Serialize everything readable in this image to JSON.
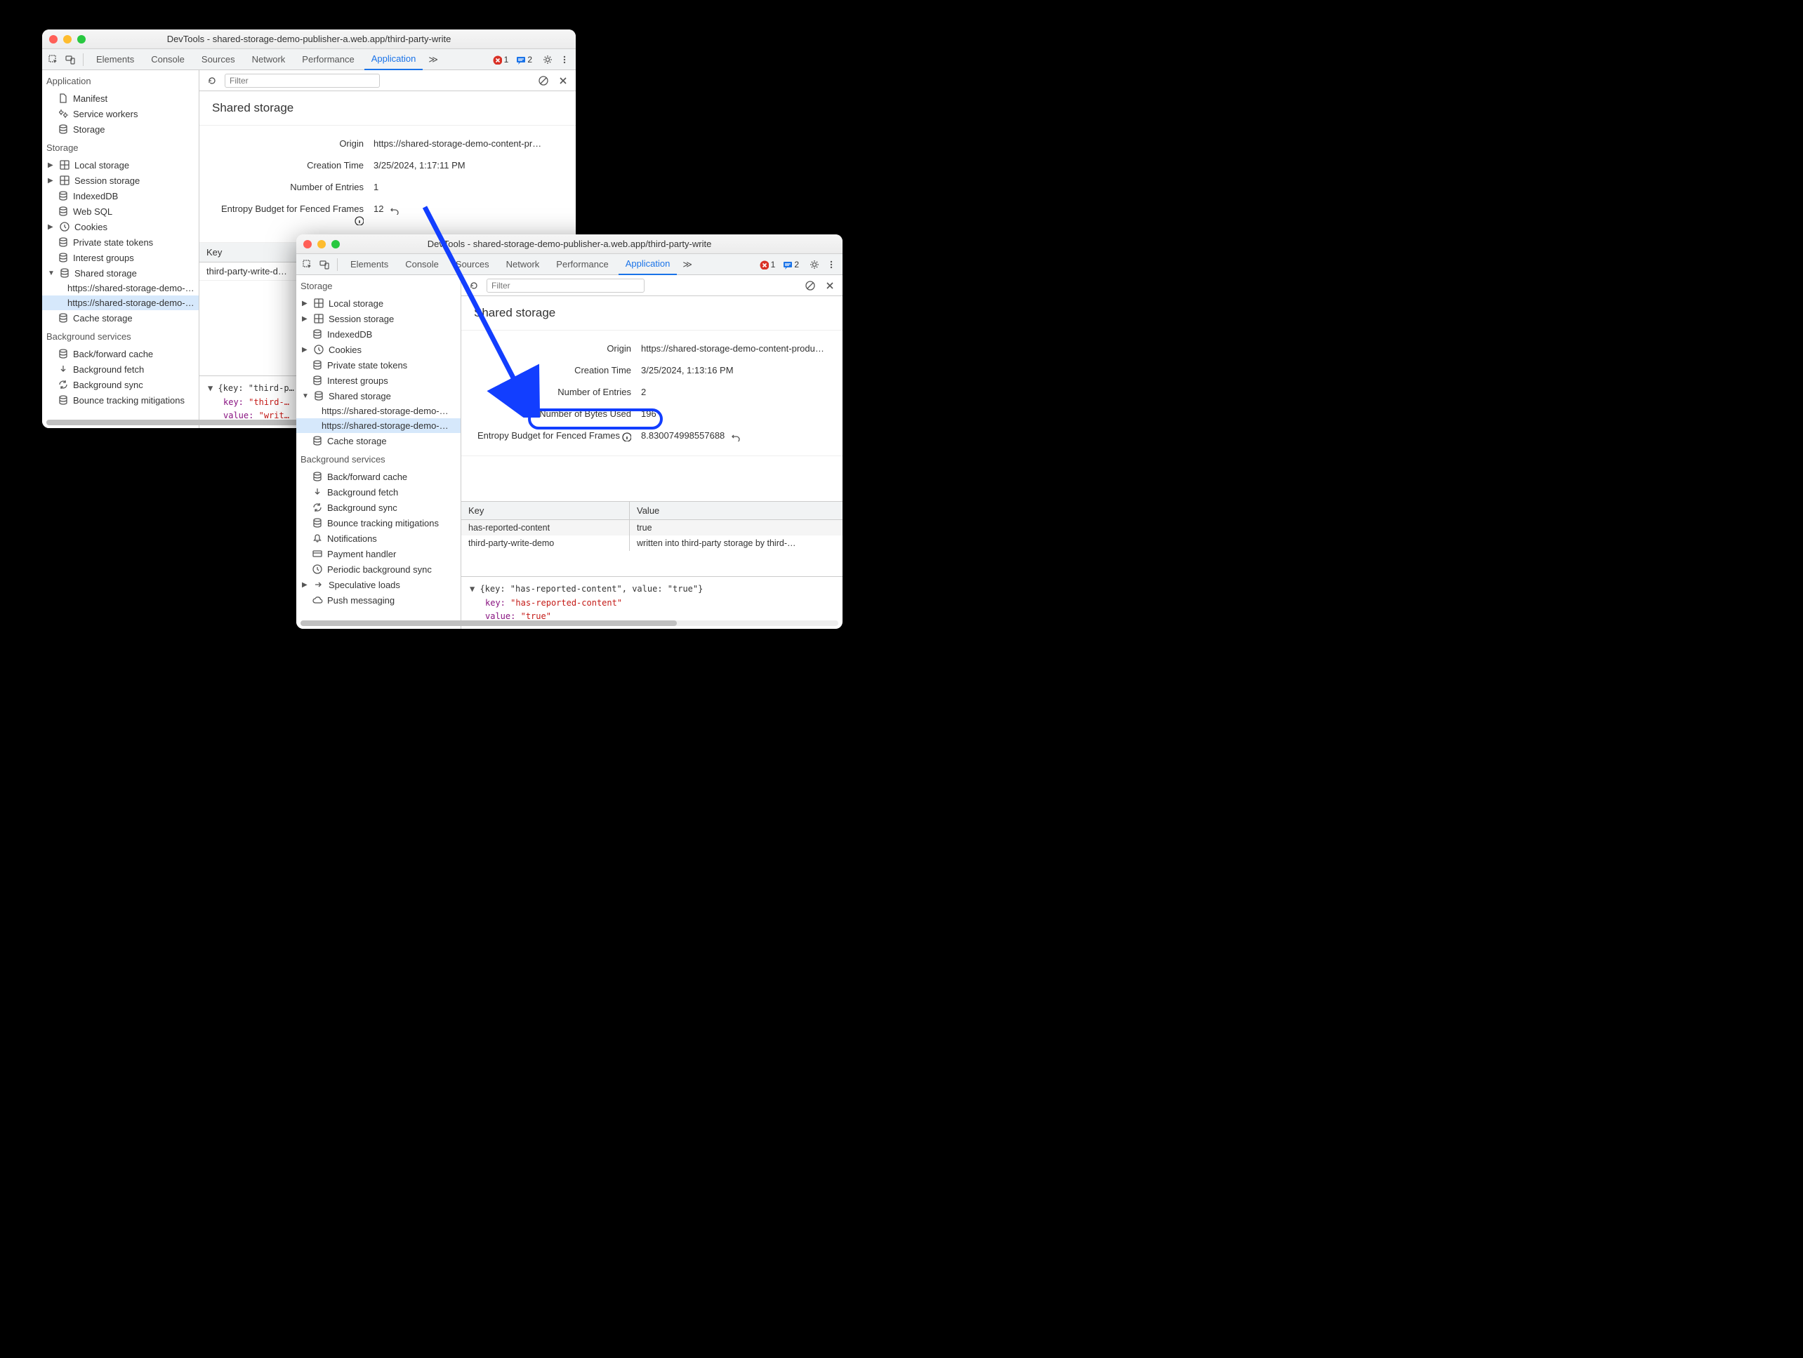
{
  "window1": {
    "title": "DevTools - shared-storage-demo-publisher-a.web.app/third-party-write",
    "tabs": [
      "Elements",
      "Console",
      "Sources",
      "Network",
      "Performance",
      "Application"
    ],
    "errors": "1",
    "infos": "2",
    "filter_placeholder": "Filter",
    "sidebar": {
      "application": "Application",
      "manifest": "Manifest",
      "service_workers": "Service workers",
      "storage_root": "Storage",
      "storage_section": "Storage",
      "local_storage": "Local storage",
      "session_storage": "Session storage",
      "indexeddb": "IndexedDB",
      "websql": "Web SQL",
      "cookies": "Cookies",
      "private_tokens": "Private state tokens",
      "interest_groups": "Interest groups",
      "shared_storage": "Shared storage",
      "shared_item1": "https://shared-storage-demo-…",
      "shared_item2": "https://shared-storage-demo-…",
      "cache_storage": "Cache storage",
      "bg_section": "Background services",
      "back_forward": "Back/forward cache",
      "bg_fetch": "Background fetch",
      "bg_sync": "Background sync",
      "bounce": "Bounce tracking mitigations"
    },
    "panel": {
      "heading": "Shared storage",
      "origin_label": "Origin",
      "origin_value": "https://shared-storage-demo-content-pr…",
      "creation_label": "Creation Time",
      "creation_value": "3/25/2024, 1:17:11 PM",
      "entries_label": "Number of Entries",
      "entries_value": "1",
      "entropy_label": "Entropy Budget for Fenced Frames",
      "entropy_value": "12",
      "key_header": "Key",
      "key_value": "third-party-write-d…",
      "detail_head": "{key: \"third-p…",
      "detail_key_label": "key:",
      "detail_key_value": "\"third-…",
      "detail_val_label": "value:",
      "detail_val_value": "\"writ…"
    }
  },
  "window2": {
    "title": "DevTools - shared-storage-demo-publisher-a.web.app/third-party-write",
    "tabs": [
      "Elements",
      "Console",
      "Sources",
      "Network",
      "Performance",
      "Application"
    ],
    "errors": "1",
    "infos": "2",
    "filter_placeholder": "Filter",
    "sidebar": {
      "storage_section": "Storage",
      "local_storage": "Local storage",
      "session_storage": "Session storage",
      "indexeddb": "IndexedDB",
      "cookies": "Cookies",
      "private_tokens": "Private state tokens",
      "interest_groups": "Interest groups",
      "shared_storage": "Shared storage",
      "shared_item1": "https://shared-storage-demo-…",
      "shared_item2": "https://shared-storage-demo-…",
      "cache_storage": "Cache storage",
      "bg_section": "Background services",
      "back_forward": "Back/forward cache",
      "bg_fetch": "Background fetch",
      "bg_sync": "Background sync",
      "bounce": "Bounce tracking mitigations",
      "notifications": "Notifications",
      "payment": "Payment handler",
      "periodic_sync": "Periodic background sync",
      "speculative": "Speculative loads",
      "push": "Push messaging"
    },
    "panel": {
      "heading": "Shared storage",
      "origin_label": "Origin",
      "origin_value": "https://shared-storage-demo-content-produ…",
      "creation_label": "Creation Time",
      "creation_value": "3/25/2024, 1:13:16 PM",
      "entries_label": "Number of Entries",
      "entries_value": "2",
      "bytes_label": "Number of Bytes Used",
      "bytes_value": "196",
      "entropy_label": "Entropy Budget for Fenced Frames",
      "entropy_value": "8.830074998557688",
      "key_header": "Key",
      "value_header": "Value",
      "row1_key": "has-reported-content",
      "row1_val": "true",
      "row2_key": "third-party-write-demo",
      "row2_val": "written into third-party storage by third-…",
      "detail_head": "{key: \"has-reported-content\", value: \"true\"}",
      "detail_key_label": "key:",
      "detail_key_value": "\"has-reported-content\"",
      "detail_val_label": "value:",
      "detail_val_value": "\"true\""
    }
  }
}
